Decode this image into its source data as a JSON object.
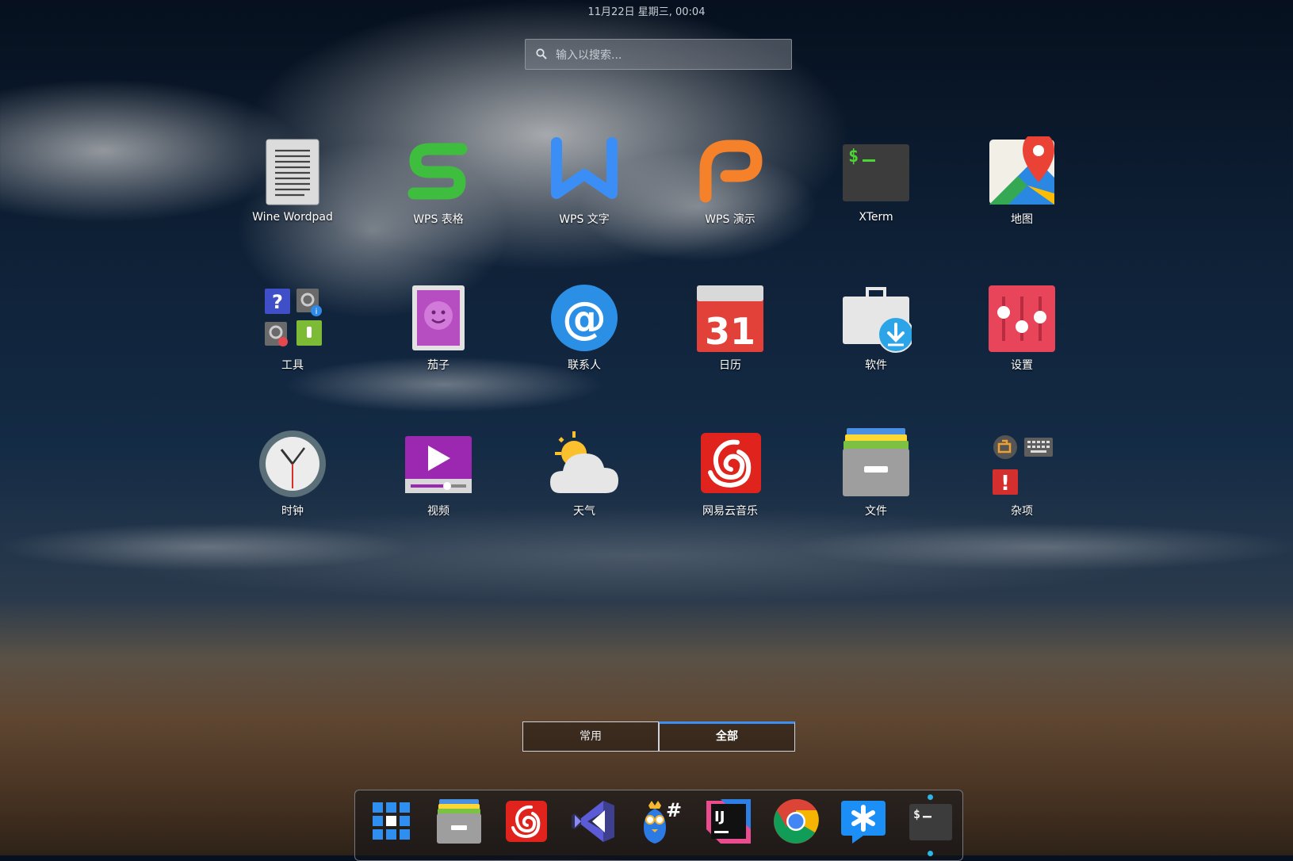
{
  "top_bar": {
    "clock": "11月22日 星期三, 00:04"
  },
  "search": {
    "placeholder": "输入以搜索...",
    "value": ""
  },
  "app_grid": {
    "rows": [
      [
        {
          "label": "Wine Wordpad",
          "icon": "wordpad-icon"
        },
        {
          "label": "WPS 表格",
          "icon": "wps-spreadsheet-icon"
        },
        {
          "label": "WPS 文字",
          "icon": "wps-writer-icon"
        },
        {
          "label": "WPS 演示",
          "icon": "wps-presentation-icon"
        },
        {
          "label": "XTerm",
          "icon": "terminal-icon"
        },
        {
          "label": "地图",
          "icon": "maps-icon"
        }
      ],
      [
        {
          "label": "工具",
          "icon": "tools-folder-icon"
        },
        {
          "label": "茄子",
          "icon": "cheese-icon"
        },
        {
          "label": "联系人",
          "icon": "contacts-icon"
        },
        {
          "label": "日历",
          "icon": "calendar-icon",
          "day": "31"
        },
        {
          "label": "软件",
          "icon": "software-icon"
        },
        {
          "label": "设置",
          "icon": "settings-icon"
        }
      ],
      [
        {
          "label": "时钟",
          "icon": "clock-icon"
        },
        {
          "label": "视频",
          "icon": "video-icon"
        },
        {
          "label": "天气",
          "icon": "weather-icon"
        },
        {
          "label": "网易云音乐",
          "icon": "netease-music-icon"
        },
        {
          "label": "文件",
          "icon": "files-icon"
        },
        {
          "label": "杂项",
          "icon": "misc-folder-icon"
        }
      ]
    ]
  },
  "categories": {
    "frequent": "常用",
    "all": "全部",
    "active": "all"
  },
  "dock": {
    "items": [
      {
        "name": "show-apps",
        "icon": "app-grid-icon"
      },
      {
        "name": "files",
        "icon": "files-icon"
      },
      {
        "name": "netease-music",
        "icon": "netease-music-icon"
      },
      {
        "name": "visual-studio-code",
        "icon": "vscode-icon"
      },
      {
        "name": "monodevelop",
        "icon": "monodevelop-icon"
      },
      {
        "name": "intellij-idea",
        "icon": "intellij-icon"
      },
      {
        "name": "chrome",
        "icon": "chrome-icon"
      },
      {
        "name": "dingtalk",
        "icon": "dingtalk-icon"
      },
      {
        "name": "terminal",
        "icon": "terminal-icon",
        "running": true
      }
    ]
  },
  "colors": {
    "accent": "#3d8ef0",
    "running_indicator": "#2cb6e8",
    "wps_green": "#3fbd3f",
    "wps_blue": "#3b8ef5",
    "wps_orange": "#f5812b",
    "calendar_red": "#e2413a",
    "settings_red": "#e8455b",
    "netease_red": "#e0231d"
  }
}
